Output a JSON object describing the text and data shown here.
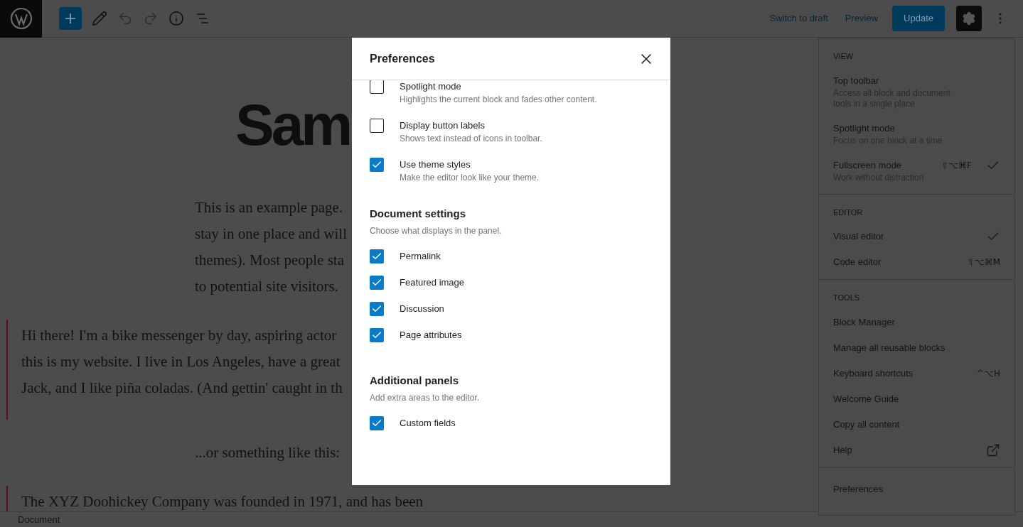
{
  "toolbar": {
    "tools": [
      {
        "kind": "add",
        "disabled": false
      },
      {
        "kind": "edit",
        "disabled": false
      },
      {
        "kind": "undo",
        "disabled": true
      },
      {
        "kind": "redo",
        "disabled": true
      },
      {
        "kind": "info",
        "disabled": false
      },
      {
        "kind": "list",
        "disabled": false
      }
    ],
    "actions": [
      {
        "kind": "link",
        "label": "Switch to draft"
      },
      {
        "kind": "link",
        "label": "Preview"
      },
      {
        "kind": "primary",
        "label": "Update"
      }
    ],
    "settings_pressed": true
  },
  "editor": {
    "title": "Sam",
    "blocks": [
      {
        "kind": "paragraph",
        "lines": [
          "This is an example page.",
          "stay in one place and will",
          "themes). Most people sta",
          "to potential site visitors."
        ]
      },
      {
        "kind": "quote",
        "lines": [
          "Hi there! I'm a bike messenger by day, aspiring actor",
          "this is my website. I live in Los Angeles, have a great",
          "Jack, and I like piña coladas. (And gettin' caught in th"
        ]
      },
      {
        "kind": "paragraph",
        "lines": [
          "...or something like this:"
        ]
      },
      {
        "kind": "quote",
        "lines": [
          "The XYZ Doohickey Company was founded in 1971, and has been"
        ]
      }
    ]
  },
  "status_bar": {
    "breadcrumb": "Document"
  },
  "menu": {
    "sections": [
      {
        "heading": "VIEW",
        "items": [
          {
            "label": "Top toolbar",
            "description": "Access all block and document tools in a single place",
            "checked": false
          },
          {
            "label": "Spotlight mode",
            "description": "Focus on one block at a time",
            "checked": false
          },
          {
            "label": "Fullscreen mode",
            "description": "Work without distraction",
            "shortcut": "⇧⌥⌘F",
            "checked": true
          }
        ]
      },
      {
        "heading": "EDITOR",
        "items": [
          {
            "label": "Visual editor",
            "checked": true
          },
          {
            "label": "Code editor",
            "shortcut": "⇧⌥⌘M",
            "checked": false
          }
        ]
      },
      {
        "heading": "TOOLS",
        "items": [
          {
            "label": "Block Manager",
            "external": false
          },
          {
            "label": "Manage all reusable blocks",
            "external": false
          },
          {
            "label": "Keyboard shortcuts",
            "shortcut": "^⌥H",
            "external": false
          },
          {
            "label": "Welcome Guide",
            "external": false
          },
          {
            "label": "Copy all content",
            "external": false
          },
          {
            "label": "Help",
            "external": true
          }
        ]
      },
      {
        "items": [
          {
            "label": "Preferences"
          }
        ]
      }
    ]
  },
  "modal": {
    "title": "Preferences",
    "sections": [
      {
        "options": [
          {
            "label": "Spotlight mode",
            "description": "Highlights the current block and fades other content.",
            "checked": false
          },
          {
            "label": "Display button labels",
            "description": "Shows text instead of icons in toolbar.",
            "checked": false
          },
          {
            "label": "Use theme styles",
            "description": "Make the editor look like your theme.",
            "checked": true
          }
        ]
      },
      {
        "heading": "Document settings",
        "description": "Choose what displays in the panel.",
        "options": [
          {
            "label": "Permalink",
            "checked": true
          },
          {
            "label": "Featured image",
            "checked": true
          },
          {
            "label": "Discussion",
            "checked": true
          },
          {
            "label": "Page attributes",
            "checked": true
          }
        ]
      },
      {
        "heading": "Additional panels",
        "description": "Add extra areas to the editor.",
        "options": [
          {
            "label": "Custom fields",
            "checked": true
          }
        ]
      }
    ]
  }
}
